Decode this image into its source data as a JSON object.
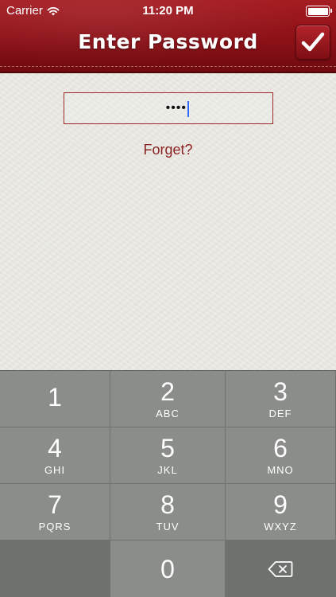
{
  "status_bar": {
    "carrier": "Carrier",
    "time": "11:20 PM"
  },
  "nav": {
    "title": "Enter Password",
    "confirm_icon": "checkmark-icon"
  },
  "password": {
    "masked_value": "••••"
  },
  "forget_link": "Forget?",
  "keypad": {
    "keys": [
      {
        "num": "1",
        "letters": ""
      },
      {
        "num": "2",
        "letters": "ABC"
      },
      {
        "num": "3",
        "letters": "DEF"
      },
      {
        "num": "4",
        "letters": "GHI"
      },
      {
        "num": "5",
        "letters": "JKL"
      },
      {
        "num": "6",
        "letters": "MNO"
      },
      {
        "num": "7",
        "letters": "PQRS"
      },
      {
        "num": "8",
        "letters": "TUV"
      },
      {
        "num": "9",
        "letters": "WXYZ"
      },
      {
        "num": "0",
        "letters": ""
      }
    ],
    "delete_icon": "backspace-icon"
  },
  "colors": {
    "header_red": "#8c1117",
    "link_red": "#8c2323",
    "key_gray": "#8a8d89",
    "key_dark_gray": "#6e716d",
    "caret_blue": "#2f6bff"
  }
}
